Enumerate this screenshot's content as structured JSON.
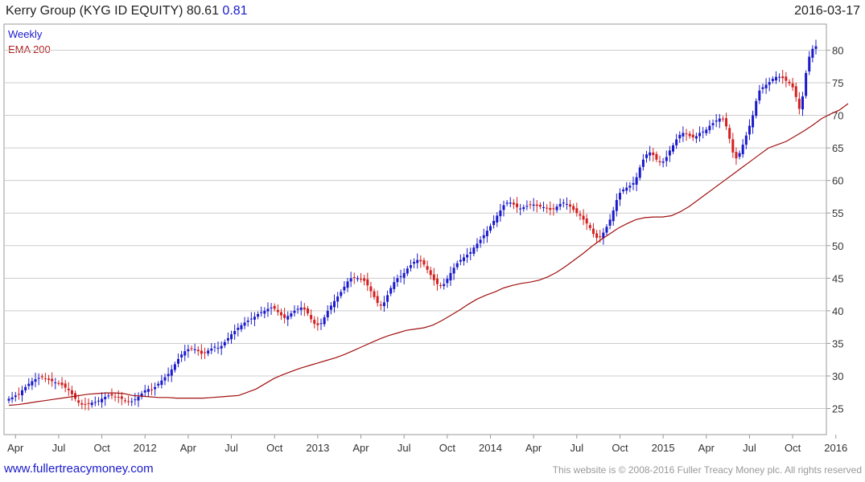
{
  "header": {
    "title": "Kerry Group (KYG ID EQUITY) 80.61",
    "change": "0.81",
    "date": "2016-03-17"
  },
  "legend": {
    "period": "Weekly",
    "indicator": "EMA 200"
  },
  "footer": {
    "url": "www.fullertreacymoney.com",
    "copyright": "This website is © 2008-2016 Fuller Treacy Money plc. All rights reserved"
  },
  "colors": {
    "up": "#1a1acc",
    "down": "#d42020",
    "ema": "#a01010",
    "grid": "#cccccc"
  },
  "chart_data": {
    "type": "candlestick",
    "title": "Kerry Group (KYG ID EQUITY)",
    "ylim": [
      21,
      84
    ],
    "yticks": [
      25,
      30,
      35,
      40,
      45,
      50,
      55,
      60,
      65,
      70,
      75,
      80
    ],
    "xticks": [
      "Apr",
      "Jul",
      "Oct",
      "2012",
      "Apr",
      "Jul",
      "Oct",
      "2013",
      "Apr",
      "Jul",
      "Oct",
      "2014",
      "Apr",
      "Jul",
      "Oct",
      "2015",
      "Apr",
      "Jul",
      "Oct",
      "2016"
    ],
    "close_series": [
      26.5,
      26.7,
      27,
      27.2,
      27.8,
      28.3,
      28.8,
      29.2,
      29.5,
      29.7,
      29.8,
      29.6,
      29.4,
      29.2,
      29,
      28.9,
      28.6,
      28.2,
      27.8,
      27.2,
      26.5,
      25.9,
      25.6,
      25.6,
      25.7,
      25.9,
      26,
      26.2,
      26.5,
      26.8,
      27,
      27,
      26.8,
      26.7,
      26.5,
      26.2,
      26,
      26.1,
      26.4,
      26.8,
      27.3,
      27.8,
      28,
      27.9,
      28.3,
      28.8,
      29.3,
      29.8,
      30.3,
      31,
      31.8,
      32.6,
      33.3,
      33.8,
      34.1,
      34.2,
      34.1,
      33.8,
      33.4,
      33.6,
      33.9,
      34.2,
      34.5,
      34.3,
      34.6,
      35.2,
      35.8,
      36.4,
      36.9,
      37.4,
      37.8,
      38.2,
      38.5,
      38.8,
      39.1,
      39.5,
      39.8,
      40,
      40.3,
      40.5,
      40.3,
      39.8,
      39.3,
      38.9,
      39.2,
      39.6,
      40,
      40.3,
      40.5,
      40.2,
      39.6,
      38.7,
      38,
      37.8,
      38.1,
      39,
      40,
      40.8,
      41.5,
      42.2,
      42.9,
      43.7,
      44.5,
      45,
      45.1,
      45,
      44.9,
      44.6,
      43.9,
      43,
      42.1,
      41.2,
      40.8,
      41.3,
      42.4,
      43.5,
      44.4,
      45,
      45.3,
      45.8,
      46.5,
      47,
      47.5,
      47.8,
      47.6,
      47.1,
      46.3,
      45.5,
      44.7,
      44.1,
      43.8,
      44.1,
      44.9,
      45.8,
      46.6,
      47.3,
      47.8,
      48.2,
      48.6,
      49,
      49.7,
      50.3,
      50.9,
      51.6,
      52.3,
      53,
      53.8,
      54.6,
      55.4,
      56.2,
      56.6,
      56.6,
      56.3,
      55.9,
      55.7,
      55.9,
      56.1,
      56.3,
      56.3,
      56.1,
      56,
      55.9,
      55.7,
      55.5,
      55.6,
      56,
      56.4,
      56.6,
      56.4,
      56,
      55.5,
      55,
      54.6,
      54,
      53.4,
      52.7,
      51.8,
      51.2,
      51.3,
      52,
      52.9,
      54,
      55.4,
      57,
      58.1,
      58.6,
      58.9,
      59.2,
      59.6,
      60.5,
      62,
      63.2,
      64,
      64.3,
      63.9,
      63.2,
      62.8,
      62.9,
      63.6,
      64.6,
      65.4,
      66.3,
      67,
      67.3,
      67.1,
      66.8,
      66.6,
      66.8,
      67.3,
      67.5,
      67.8,
      68.4,
      68.8,
      69.2,
      69.5,
      69.4,
      68.3,
      66.4,
      64.3,
      63.4,
      64.2,
      65.5,
      66.9,
      68.4,
      70,
      72.2,
      73.8,
      74.3,
      74.7,
      75.1,
      75.6,
      75.9,
      75.9,
      75.7,
      75.3,
      74.9,
      74.3,
      72.8,
      71,
      72.9,
      76.5,
      79,
      80.2,
      80.6
    ],
    "ema_series": [
      25.5,
      25.6,
      25.8,
      26,
      26.2,
      26.4,
      26.6,
      26.8,
      27,
      27.2,
      27.3,
      27.4,
      27.4,
      27.3,
      27,
      26.9,
      26.8,
      26.7,
      26.7,
      26.6,
      26.6,
      26.6,
      26.6,
      26.7,
      26.8,
      26.9,
      27,
      27.5,
      28,
      28.8,
      29.6,
      30.2,
      30.7,
      31.2,
      31.6,
      32,
      32.4,
      32.8,
      33.3,
      33.9,
      34.5,
      35.1,
      35.7,
      36.2,
      36.6,
      37,
      37.2,
      37.4,
      37.8,
      38.5,
      39.3,
      40.1,
      41,
      41.8,
      42.4,
      42.9,
      43.5,
      43.9,
      44.2,
      44.4,
      44.7,
      45.2,
      45.9,
      46.8,
      47.8,
      48.8,
      49.9,
      50.9,
      51.8,
      52.7,
      53.4,
      54,
      54.3,
      54.4,
      54.4,
      54.6,
      55.2,
      56,
      57,
      58,
      59,
      60,
      61,
      62,
      63,
      64,
      65,
      65.5,
      66,
      66.8,
      67.6,
      68.5,
      69.5,
      70.2,
      70.8,
      71.8
    ],
    "ema_start_week": 0,
    "ema_step_weeks": 2.66
  }
}
